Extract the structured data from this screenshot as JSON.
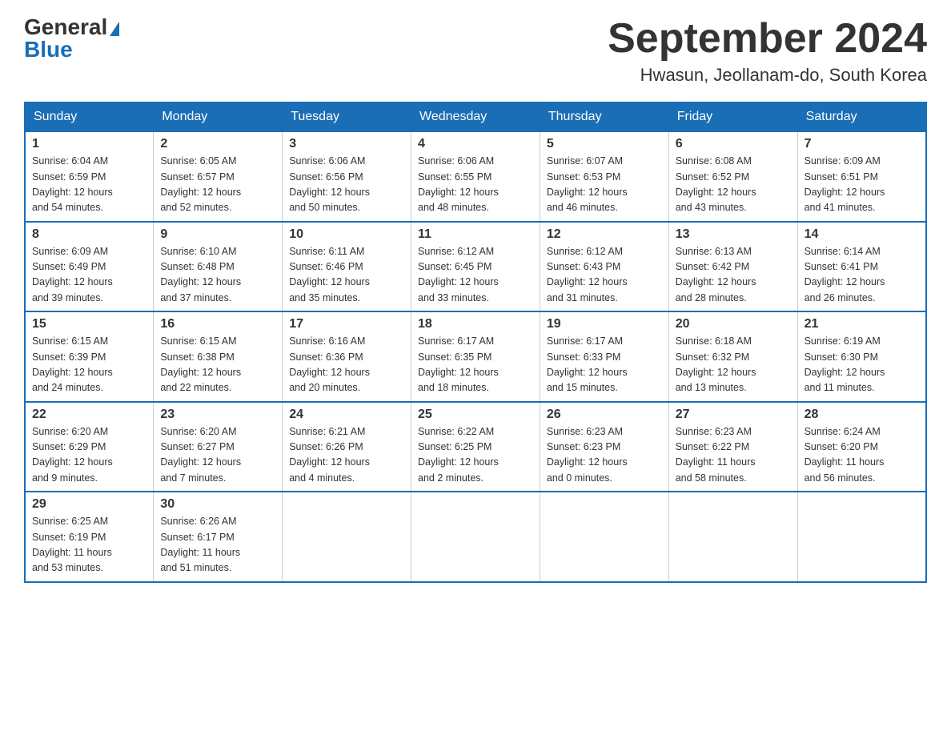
{
  "header": {
    "logo_general": "General",
    "logo_blue": "Blue",
    "month_title": "September 2024",
    "location": "Hwasun, Jeollanam-do, South Korea"
  },
  "weekdays": [
    "Sunday",
    "Monday",
    "Tuesday",
    "Wednesday",
    "Thursday",
    "Friday",
    "Saturday"
  ],
  "weeks": [
    [
      {
        "day": "1",
        "sunrise": "6:04 AM",
        "sunset": "6:59 PM",
        "daylight": "12 hours and 54 minutes."
      },
      {
        "day": "2",
        "sunrise": "6:05 AM",
        "sunset": "6:57 PM",
        "daylight": "12 hours and 52 minutes."
      },
      {
        "day": "3",
        "sunrise": "6:06 AM",
        "sunset": "6:56 PM",
        "daylight": "12 hours and 50 minutes."
      },
      {
        "day": "4",
        "sunrise": "6:06 AM",
        "sunset": "6:55 PM",
        "daylight": "12 hours and 48 minutes."
      },
      {
        "day": "5",
        "sunrise": "6:07 AM",
        "sunset": "6:53 PM",
        "daylight": "12 hours and 46 minutes."
      },
      {
        "day": "6",
        "sunrise": "6:08 AM",
        "sunset": "6:52 PM",
        "daylight": "12 hours and 43 minutes."
      },
      {
        "day": "7",
        "sunrise": "6:09 AM",
        "sunset": "6:51 PM",
        "daylight": "12 hours and 41 minutes."
      }
    ],
    [
      {
        "day": "8",
        "sunrise": "6:09 AM",
        "sunset": "6:49 PM",
        "daylight": "12 hours and 39 minutes."
      },
      {
        "day": "9",
        "sunrise": "6:10 AM",
        "sunset": "6:48 PM",
        "daylight": "12 hours and 37 minutes."
      },
      {
        "day": "10",
        "sunrise": "6:11 AM",
        "sunset": "6:46 PM",
        "daylight": "12 hours and 35 minutes."
      },
      {
        "day": "11",
        "sunrise": "6:12 AM",
        "sunset": "6:45 PM",
        "daylight": "12 hours and 33 minutes."
      },
      {
        "day": "12",
        "sunrise": "6:12 AM",
        "sunset": "6:43 PM",
        "daylight": "12 hours and 31 minutes."
      },
      {
        "day": "13",
        "sunrise": "6:13 AM",
        "sunset": "6:42 PM",
        "daylight": "12 hours and 28 minutes."
      },
      {
        "day": "14",
        "sunrise": "6:14 AM",
        "sunset": "6:41 PM",
        "daylight": "12 hours and 26 minutes."
      }
    ],
    [
      {
        "day": "15",
        "sunrise": "6:15 AM",
        "sunset": "6:39 PM",
        "daylight": "12 hours and 24 minutes."
      },
      {
        "day": "16",
        "sunrise": "6:15 AM",
        "sunset": "6:38 PM",
        "daylight": "12 hours and 22 minutes."
      },
      {
        "day": "17",
        "sunrise": "6:16 AM",
        "sunset": "6:36 PM",
        "daylight": "12 hours and 20 minutes."
      },
      {
        "day": "18",
        "sunrise": "6:17 AM",
        "sunset": "6:35 PM",
        "daylight": "12 hours and 18 minutes."
      },
      {
        "day": "19",
        "sunrise": "6:17 AM",
        "sunset": "6:33 PM",
        "daylight": "12 hours and 15 minutes."
      },
      {
        "day": "20",
        "sunrise": "6:18 AM",
        "sunset": "6:32 PM",
        "daylight": "12 hours and 13 minutes."
      },
      {
        "day": "21",
        "sunrise": "6:19 AM",
        "sunset": "6:30 PM",
        "daylight": "12 hours and 11 minutes."
      }
    ],
    [
      {
        "day": "22",
        "sunrise": "6:20 AM",
        "sunset": "6:29 PM",
        "daylight": "12 hours and 9 minutes."
      },
      {
        "day": "23",
        "sunrise": "6:20 AM",
        "sunset": "6:27 PM",
        "daylight": "12 hours and 7 minutes."
      },
      {
        "day": "24",
        "sunrise": "6:21 AM",
        "sunset": "6:26 PM",
        "daylight": "12 hours and 4 minutes."
      },
      {
        "day": "25",
        "sunrise": "6:22 AM",
        "sunset": "6:25 PM",
        "daylight": "12 hours and 2 minutes."
      },
      {
        "day": "26",
        "sunrise": "6:23 AM",
        "sunset": "6:23 PM",
        "daylight": "12 hours and 0 minutes."
      },
      {
        "day": "27",
        "sunrise": "6:23 AM",
        "sunset": "6:22 PM",
        "daylight": "11 hours and 58 minutes."
      },
      {
        "day": "28",
        "sunrise": "6:24 AM",
        "sunset": "6:20 PM",
        "daylight": "11 hours and 56 minutes."
      }
    ],
    [
      {
        "day": "29",
        "sunrise": "6:25 AM",
        "sunset": "6:19 PM",
        "daylight": "11 hours and 53 minutes."
      },
      {
        "day": "30",
        "sunrise": "6:26 AM",
        "sunset": "6:17 PM",
        "daylight": "11 hours and 51 minutes."
      },
      null,
      null,
      null,
      null,
      null
    ]
  ]
}
